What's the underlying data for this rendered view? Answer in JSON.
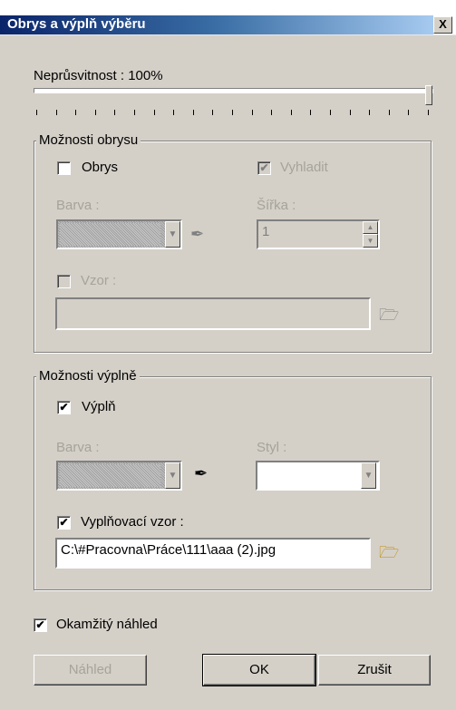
{
  "window": {
    "title": "Obrys a výplň výběru",
    "close_label": "X"
  },
  "opacity": {
    "label": "Neprůsvitnost : 100%",
    "value": 100
  },
  "outline_group": {
    "legend": "Možnosti obrysu",
    "outline_label": "Obrys",
    "outline_checked": false,
    "smooth_label": "Vyhladit",
    "smooth_checked": true,
    "color_label": "Barva :",
    "width_label": "Šířka :",
    "width_value": "1",
    "pattern_label": "Vzor :",
    "pattern_value": ""
  },
  "fill_group": {
    "legend": "Možnosti výplně",
    "fill_label": "Výplň",
    "fill_checked": true,
    "color_label": "Barva :",
    "style_label": "Styl :",
    "style_value": "",
    "fill_pattern_label": "Vyplňovací vzor :",
    "fill_pattern_checked": true,
    "fill_pattern_value": "C:\\#Pracovna\\Práce\\111\\aaa (2).jpg"
  },
  "instant_preview": {
    "label": "Okamžitý náhled",
    "checked": true
  },
  "buttons": {
    "preview": "Náhled",
    "ok": "OK",
    "cancel": "Zrušit"
  },
  "icons": {
    "eyedropper": "eyedropper-icon",
    "folder": "open-folder-icon",
    "check": "✔"
  }
}
